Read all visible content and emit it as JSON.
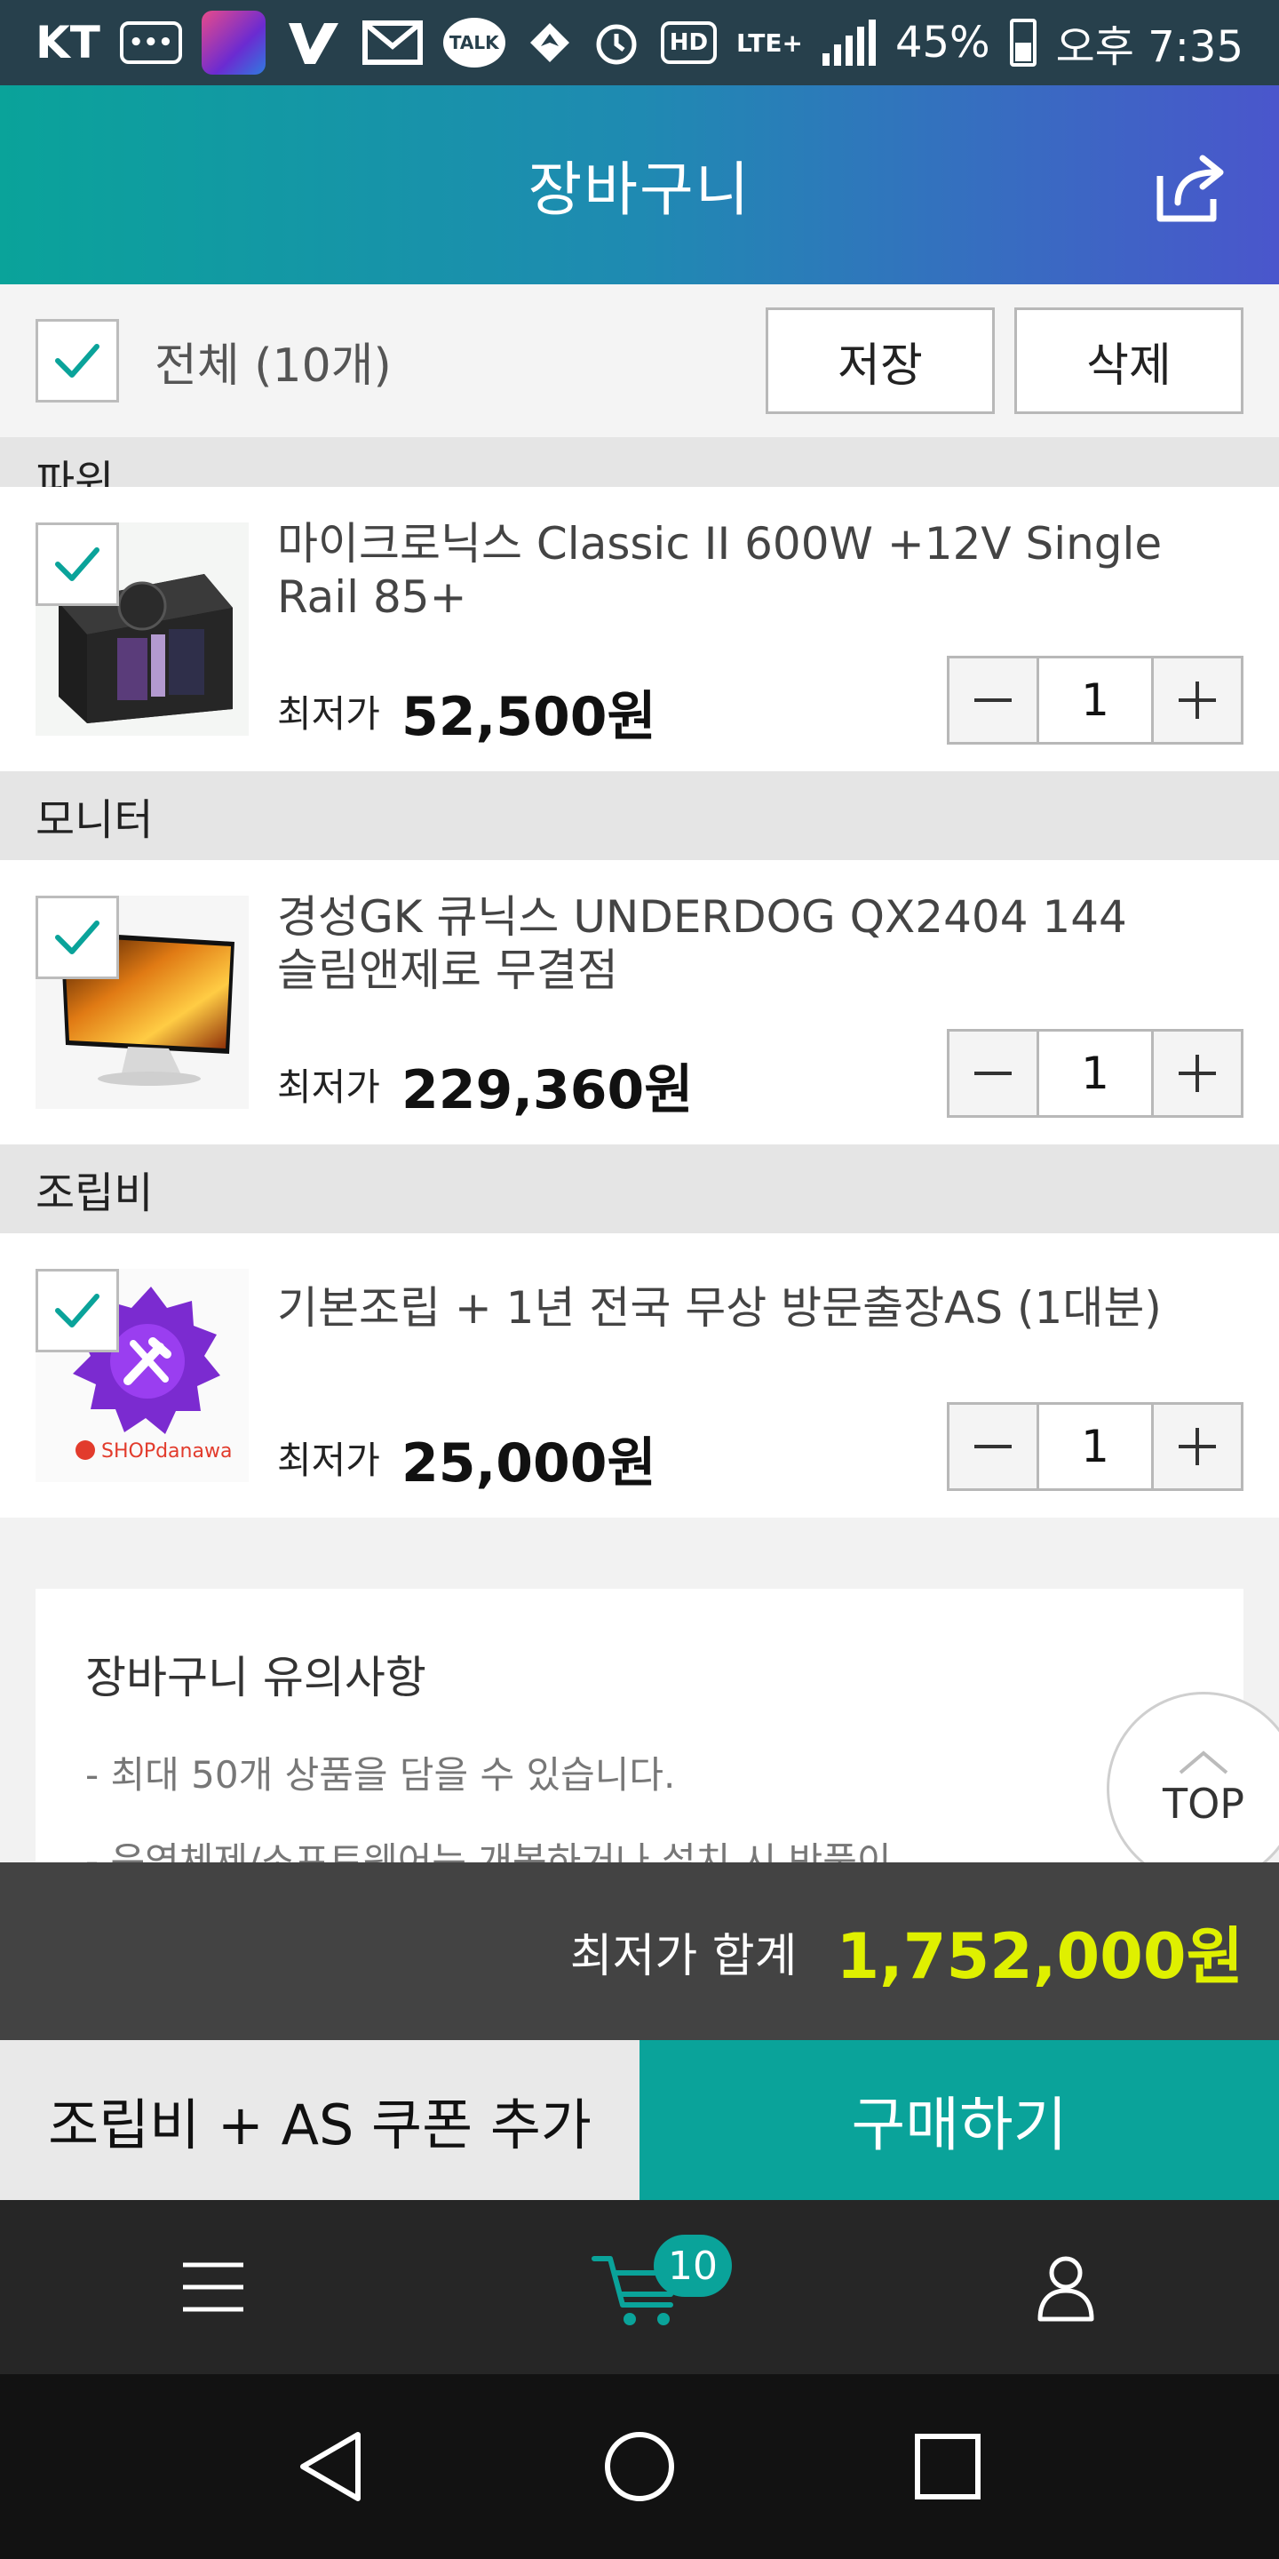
{
  "status_bar": {
    "carrier": "KT",
    "talk_icon_text": "TALK",
    "hd_text": "HD",
    "network": "LTE+",
    "battery": "45%",
    "time": "오후 7:35"
  },
  "header": {
    "title": "장바구니",
    "share_icon": "share-icon"
  },
  "toolbar": {
    "select_all_label": "전체 (10개)",
    "select_all_checked": true,
    "save_label": "저장",
    "delete_label": "삭제"
  },
  "cart": {
    "price_label": "최저가",
    "partial_category": "파워",
    "sections": [
      {
        "category": "파워",
        "item": {
          "name": "마이크로닉스 Classic II 600W +12V Single Rail 85+",
          "price": "52,500원",
          "quantity": "1",
          "checked": true
        }
      },
      {
        "category": "모니터",
        "item": {
          "name": "경성GK 큐닉스 UNDERDOG QX2404 144 슬림앤제로 무결점",
          "price": "229,360원",
          "quantity": "1",
          "checked": true
        }
      },
      {
        "category": "조립비",
        "item": {
          "name": "기본조립 + 1년 전국 무상 방문출장AS (1대분)",
          "price": "25,000원",
          "quantity": "1",
          "checked": true,
          "brand_text": "SHOPdanawa"
        }
      }
    ]
  },
  "notice": {
    "title": "장바구니 유의사항",
    "lines": [
      "- 최대 50개 상품을 담을 수 있습니다.",
      "- 운영체제/소프트웨어는 개봉하거나 설치 시 반품이"
    ]
  },
  "top_button": {
    "label": "TOP"
  },
  "total": {
    "label": "최저가 합계",
    "value": "1,752,000원"
  },
  "actions": {
    "coupon_label": "조립비 + AS 쿠폰 추가",
    "buy_label": "구매하기"
  },
  "bottom_nav": {
    "cart_badge": "10"
  },
  "colors": {
    "accent": "#0aa39a",
    "total_value": "#dff000",
    "header_gradient_start": "#0aa39a",
    "header_gradient_end": "#4a56cc"
  }
}
